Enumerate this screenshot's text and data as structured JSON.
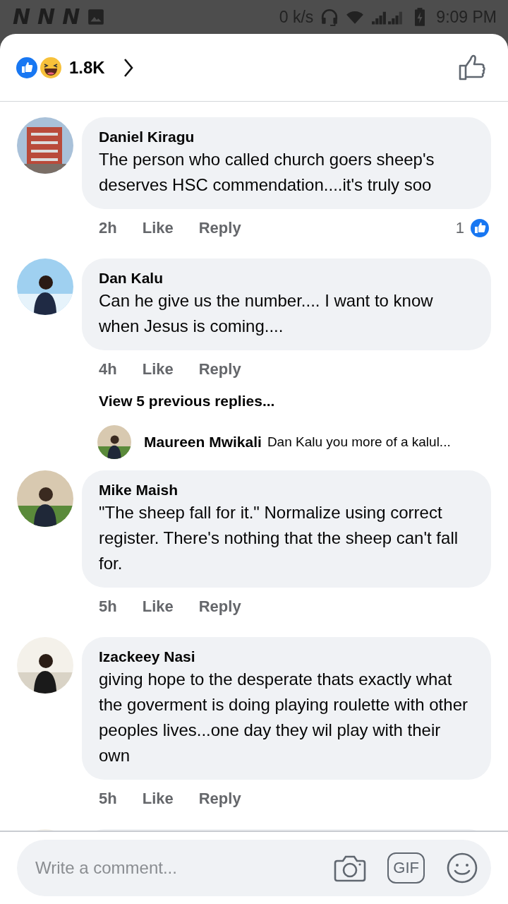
{
  "status_bar": {
    "notification_icons": [
      "N",
      "N",
      "N"
    ],
    "speed": "0 k/s",
    "time": "9:09 PM"
  },
  "header": {
    "reaction_count": "1.8K"
  },
  "comments": [
    {
      "name": "Daniel Kiragu",
      "text": "The person who called church goers sheep's deserves HSC commendation....it's truly soo",
      "time": "2h",
      "actions": [
        "Like",
        "Reply"
      ],
      "like_count": "1"
    },
    {
      "name": "Dan Kalu",
      "text": "Can he give us the number.... I want to know when Jesus is coming....",
      "time": "4h",
      "actions": [
        "Like",
        "Reply"
      ],
      "replies_link": "View 5 previous replies...",
      "reply_preview": {
        "name": "Maureen Mwikali",
        "text": "Dan Kalu you more of a kalul..."
      }
    },
    {
      "name": "Mike Maish",
      "text": "\"The sheep fall for it.\" Normalize using correct register. There's nothing that the sheep can't fall for.",
      "time": "5h",
      "actions": [
        "Like",
        "Reply"
      ]
    },
    {
      "name": "Izackeey Nasi",
      "text": "giving hope to the desperate thats exactly what the goverment is doing playing roulette with other peoples lives...one day they wil play with their own",
      "time": "5h",
      "actions": [
        "Like",
        "Reply"
      ]
    }
  ],
  "composer": {
    "placeholder": "Write a comment...",
    "gif_label": "GIF"
  }
}
